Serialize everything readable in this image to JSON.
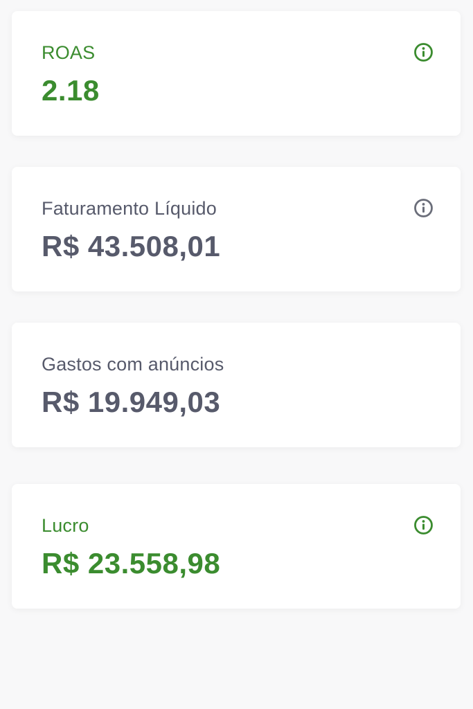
{
  "colors": {
    "accent_green": "#3b8c2f",
    "text_gray": "#575a6b",
    "icon_gray": "#6b6e7a",
    "card_bg": "#ffffff",
    "page_bg": "#f8f8f9"
  },
  "cards": [
    {
      "label": "ROAS",
      "value": "2.18",
      "color": "green",
      "icon": "info-icon"
    },
    {
      "label": "Faturamento Líquido",
      "value": "R$ 43.508,01",
      "color": "gray",
      "icon": "info-icon"
    },
    {
      "label": "Gastos com anúncios",
      "value": "R$ 19.949,03",
      "color": "gray",
      "icon": null
    },
    {
      "label": "Lucro",
      "value": "R$ 23.558,98",
      "color": "green",
      "icon": "info-icon"
    }
  ]
}
